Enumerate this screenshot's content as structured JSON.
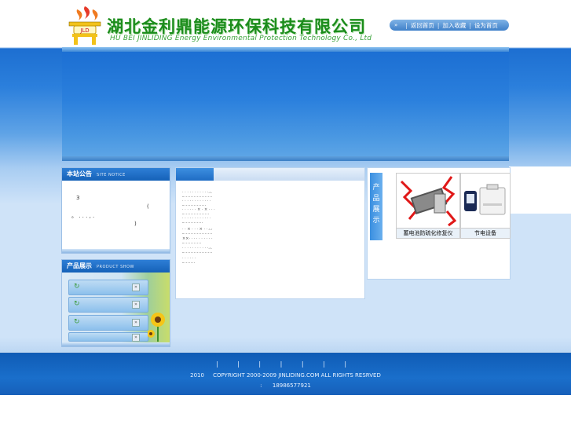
{
  "header": {
    "company_name": "湖北金利鼎能源环保科技有限公司",
    "company_en": "HU BEI  JINLIDING  Energy Environmental Protection Technology Co., Ltd",
    "logo_text": "JLD",
    "topnav": {
      "arrow": "»",
      "home": "返回首页",
      "favorite": "加入收藏",
      "set_home": "设为首页"
    }
  },
  "notice": {
    "title": "本站公告",
    "title_en": "SITE NOTICE",
    "lines": [
      "3",
      "(",
      "。 . . . , .",
      ")"
    ]
  },
  "products_left": {
    "title": "产品展示",
    "title_en": "PRODUCT SHOW",
    "items": [
      {
        "icon": "refresh-icon",
        "go": "»"
      },
      {
        "icon": "refresh-icon",
        "go": "»"
      },
      {
        "icon": "refresh-icon",
        "go": "»"
      },
      {
        "icon": "refresh-icon",
        "go": "»"
      }
    ]
  },
  "news": {
    "lines": [
      {
        "text": "· · · · · · · · · · · ·",
        "date": "..."
      },
      {
        "text": "· · · · · · · · · · · ·",
        "date": ""
      },
      {
        "text": "· · · · · · × · × · · ·",
        "date": ""
      },
      {
        "text": "· · · · · · · · · · · ·",
        "date": ""
      },
      {
        "text": "· · × · · · × · · · ·",
        "date": "..."
      },
      {
        "text": "××· · · · · · · · · ·",
        "date": ""
      },
      {
        "text": "· · · · · · · · · · · ·",
        "date": "..."
      },
      {
        "text": "· · · · · ·",
        "date": ""
      }
    ]
  },
  "showcase": {
    "tab_label": [
      "产",
      "品",
      "展",
      "示"
    ],
    "cards": [
      {
        "caption": "蓄电池防硫化修复仪"
      },
      {
        "caption": "节电设备"
      }
    ]
  },
  "footer": {
    "links": "| | | | | | |",
    "copyright_year": "2010",
    "copyright": "COPYRIGHT 2000-2009 JINLIDING.COM ALL RIGHTS RESRVED",
    "phone_label": ":",
    "phone": "18986577921"
  },
  "colors": {
    "brand_green": "#1b8c1b",
    "brand_blue": "#1d6fd1"
  }
}
